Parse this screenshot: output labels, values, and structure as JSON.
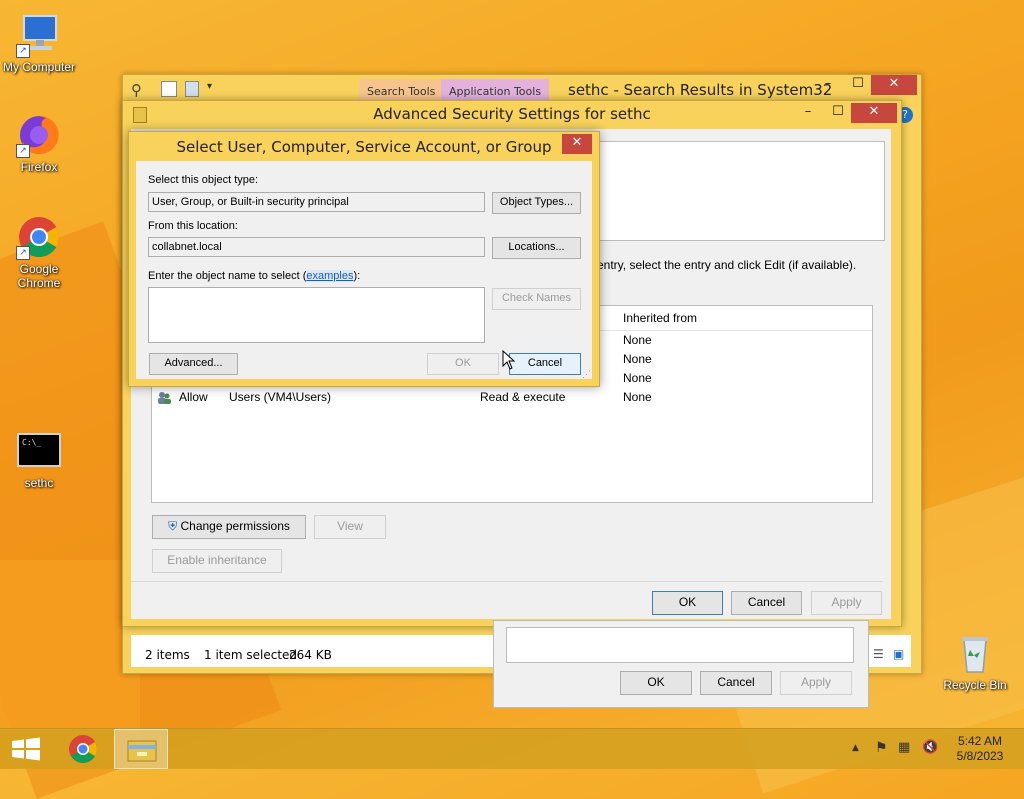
{
  "desktop": {
    "icons": [
      {
        "label": "My Computer"
      },
      {
        "label": "Firefox"
      },
      {
        "label": "Google Chrome"
      },
      {
        "label": "sethc"
      },
      {
        "label": "Recycle Bin"
      }
    ]
  },
  "explorer": {
    "title": "sethc - Search Results in System32",
    "context_tabs": [
      "Search Tools",
      "Application Tools"
    ],
    "status": {
      "items": "2 items",
      "selected": "1 item selected",
      "size": "264 KB"
    }
  },
  "advanced_security": {
    "title": "Advanced Security Settings for sethc",
    "instruction": "entry, select the entry and click Edit (if available).",
    "column_inherited": "Inherited from",
    "rows": [
      {
        "type": "",
        "principal": "",
        "access": "",
        "inherited": "None"
      },
      {
        "type": "",
        "principal": "",
        "access": "",
        "inherited": "None"
      },
      {
        "type": "",
        "principal": "",
        "access": "",
        "inherited": "None"
      },
      {
        "type": "Allow",
        "principal": "Users (VM4\\Users)",
        "access": "Read & execute",
        "inherited": "None"
      }
    ],
    "buttons": {
      "change_permissions": "Change permissions",
      "view": "View",
      "enable_inheritance": "Enable inheritance",
      "ok": "OK",
      "cancel": "Cancel",
      "apply": "Apply"
    }
  },
  "third_dialog": {
    "buttons": {
      "ok": "OK",
      "cancel": "Cancel",
      "apply": "Apply"
    }
  },
  "select_dialog": {
    "title": "Select User, Computer, Service Account, or Group",
    "object_type_label": "Select this object type:",
    "object_type_value": "User, Group, or Built-in security principal",
    "object_types_button": "Object Types...",
    "location_label": "From this location:",
    "location_value": "collabnet.local",
    "locations_button": "Locations...",
    "enter_label": "Enter the object name to select (",
    "examples_link": "examples",
    "enter_label_end": "):",
    "check_names_button": "Check Names",
    "advanced_button": "Advanced...",
    "ok_button": "OK",
    "cancel_button": "Cancel"
  },
  "taskbar": {
    "time": "5:42 AM",
    "date": "5/8/2023"
  },
  "colors": {
    "accent": "#f8d25a",
    "close": "#c7463d",
    "link": "#1a5fb4"
  }
}
